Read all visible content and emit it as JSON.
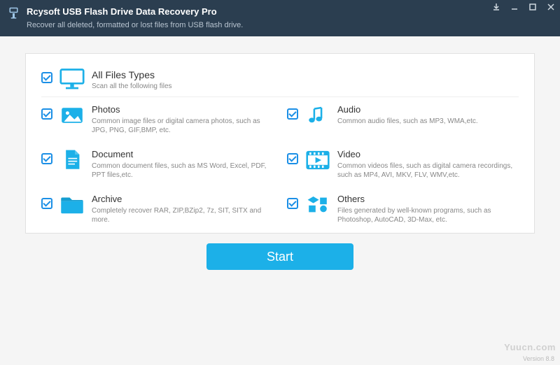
{
  "app": {
    "title": "Rcysoft USB Flash Drive Data Recovery Pro",
    "subtitle": "Recover all deleted, formatted or lost files from USB flash drive."
  },
  "allTypes": {
    "title": "All Files Types",
    "desc": "Scan all the following files"
  },
  "categories": [
    {
      "id": "photos",
      "title": "Photos",
      "desc": "Common image files or digital camera photos, such as JPG, PNG, GIF,BMP, etc."
    },
    {
      "id": "audio",
      "title": "Audio",
      "desc": "Common audio files, such as MP3, WMA,etc."
    },
    {
      "id": "document",
      "title": "Document",
      "desc": "Common document files, such as MS Word, Excel, PDF, PPT files,etc."
    },
    {
      "id": "video",
      "title": "Video",
      "desc": "Common videos files, such as digital camera recordings, such as MP4, AVI, MKV, FLV, WMV,etc."
    },
    {
      "id": "archive",
      "title": "Archive",
      "desc": "Completely recover RAR, ZIP,BZip2, 7z, SIT, SITX and more."
    },
    {
      "id": "others",
      "title": "Others",
      "desc": "Files generated by well-known programs, such as Photoshop, AutoCAD, 3D-Max, etc."
    }
  ],
  "actions": {
    "start": "Start"
  },
  "footer": {
    "version": "Version 8.8",
    "watermark": "Yuucn.com"
  },
  "colors": {
    "accent": "#1cb0e8"
  }
}
